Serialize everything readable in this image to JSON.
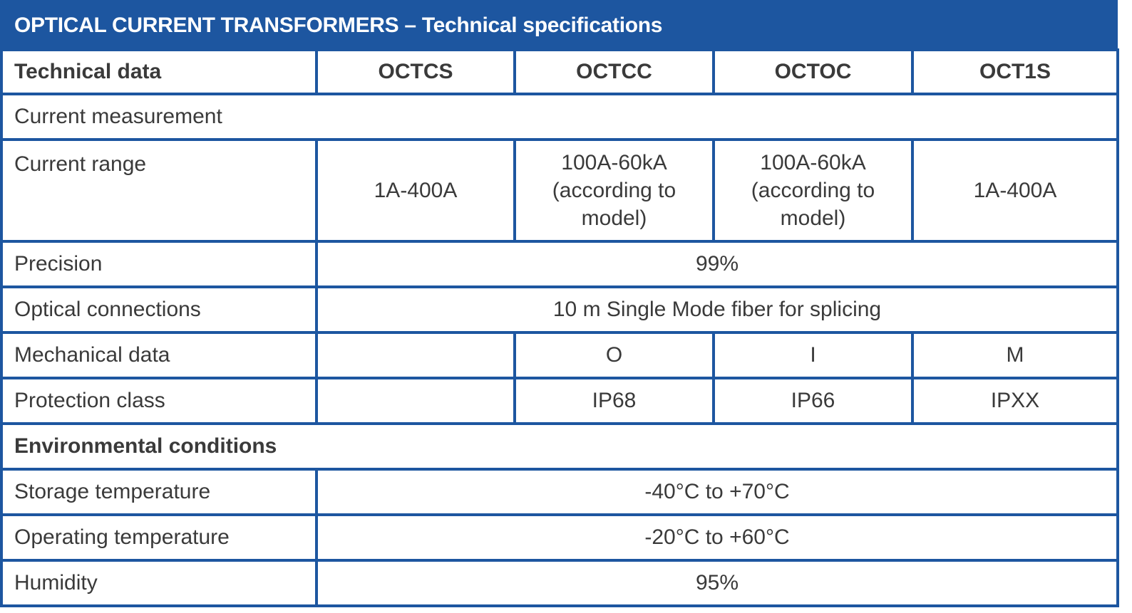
{
  "title": "OPTICAL CURRENT TRANSFORMERS – Technical specifications",
  "header": {
    "label": "Technical data",
    "models": [
      "OCTCS",
      "OCTCC",
      "OCTOC",
      "OCT1S"
    ]
  },
  "sections": {
    "current_measurement": "Current measurement",
    "environmental_conditions": "Environmental conditions"
  },
  "rows": {
    "current_range": {
      "label": "Current range",
      "values": [
        "1A-400A",
        "100A-60kA (according to model)",
        "100A-60kA (according to model)",
        "1A-400A"
      ]
    },
    "precision": {
      "label": "Precision",
      "value": "99%"
    },
    "optical_connections": {
      "label": "Optical connections",
      "value": "10 m Single Mode fiber for splicing"
    },
    "mechanical_data": {
      "label": "Mechanical data",
      "values": [
        "",
        "O",
        "I",
        "M"
      ]
    },
    "protection_class": {
      "label": "Protection class",
      "values": [
        "",
        "IP68",
        "IP66",
        "IPXX"
      ]
    },
    "storage_temperature": {
      "label": "Storage temperature",
      "value": "-40°C to +70°C"
    },
    "operating_temperature": {
      "label": "Operating temperature",
      "value": "-20°C to +60°C"
    },
    "humidity": {
      "label": "Humidity",
      "value": "95%"
    }
  },
  "colors": {
    "brand_blue": "#1d56a0",
    "text": "#3a3a3a"
  }
}
